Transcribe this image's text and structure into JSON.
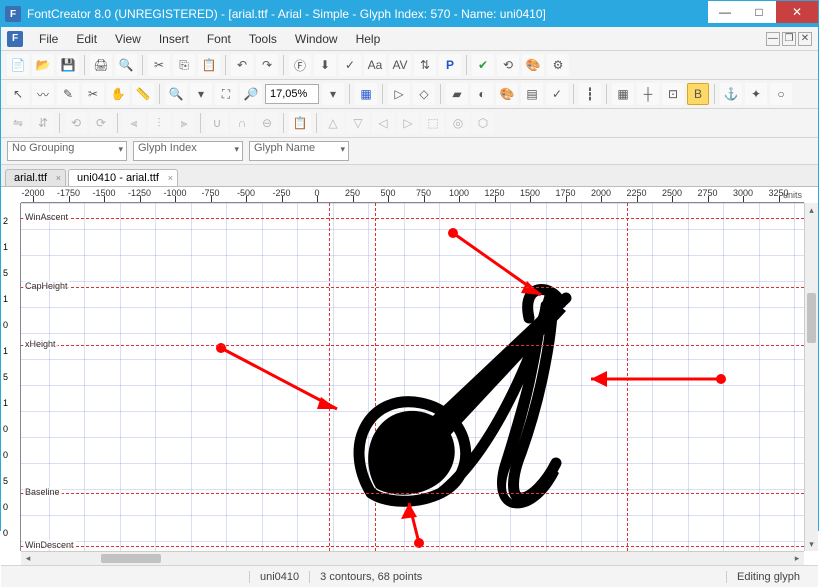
{
  "title": "FontCreator 8.0 (UNREGISTERED) - [arial.ttf - Arial - Simple - Glyph Index: 570 - Name: uni0410]",
  "menu": [
    "File",
    "Edit",
    "View",
    "Insert",
    "Font",
    "Tools",
    "Window",
    "Help"
  ],
  "zoom": "17,05%",
  "filter": {
    "grouping": "No Grouping",
    "index": "Glyph Index",
    "name": "Glyph Name"
  },
  "tabs": [
    {
      "label": "arial.ttf",
      "active": false
    },
    {
      "label": "uni0410 - arial.ttf",
      "active": true
    }
  ],
  "ruler_h": [
    -2000,
    -1750,
    -1500,
    -1250,
    -1000,
    -750,
    -500,
    -250,
    0,
    250,
    500,
    750,
    1000,
    1250,
    1500,
    1750,
    2000,
    2250,
    2500,
    2750,
    3000,
    3250
  ],
  "ruler_units": "units",
  "ruler_v": [
    "2",
    "1",
    "5",
    "1",
    "0",
    "1",
    "5",
    "1",
    "0",
    "0",
    "5",
    "0",
    "0"
  ],
  "metrics": {
    "WinAscent": 15,
    "CapHeight": 84,
    "xHeight": 142,
    "Baseline": 290,
    "WinDescent": 343
  },
  "v_metrics": {
    "left_sidebearing": 308,
    "origin": 354,
    "right_sidebearing": 606
  },
  "status": {
    "glyph": "uni0410",
    "info": "3 contours, 68 points",
    "mode": "Editing glyph"
  }
}
